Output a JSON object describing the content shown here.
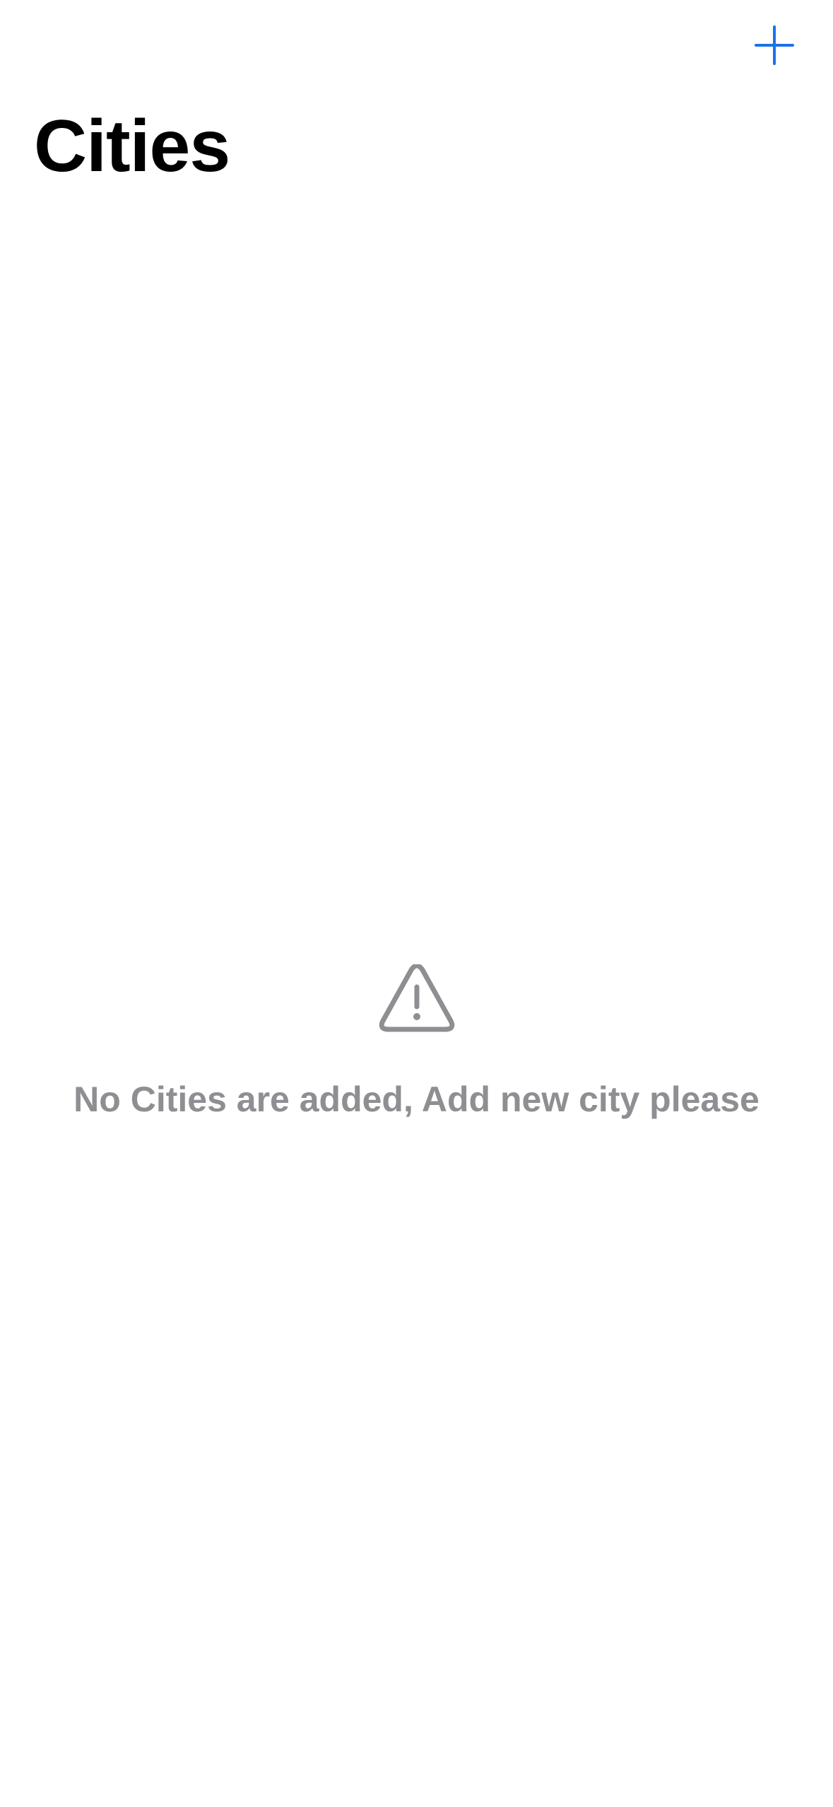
{
  "header": {
    "title": "Cities",
    "add_icon": "plus-icon",
    "accent_color": "#1a73e8"
  },
  "empty_state": {
    "icon": "warning-triangle-icon",
    "message": "No Cities are added, Add new city please",
    "text_color": "#8e8e93"
  }
}
